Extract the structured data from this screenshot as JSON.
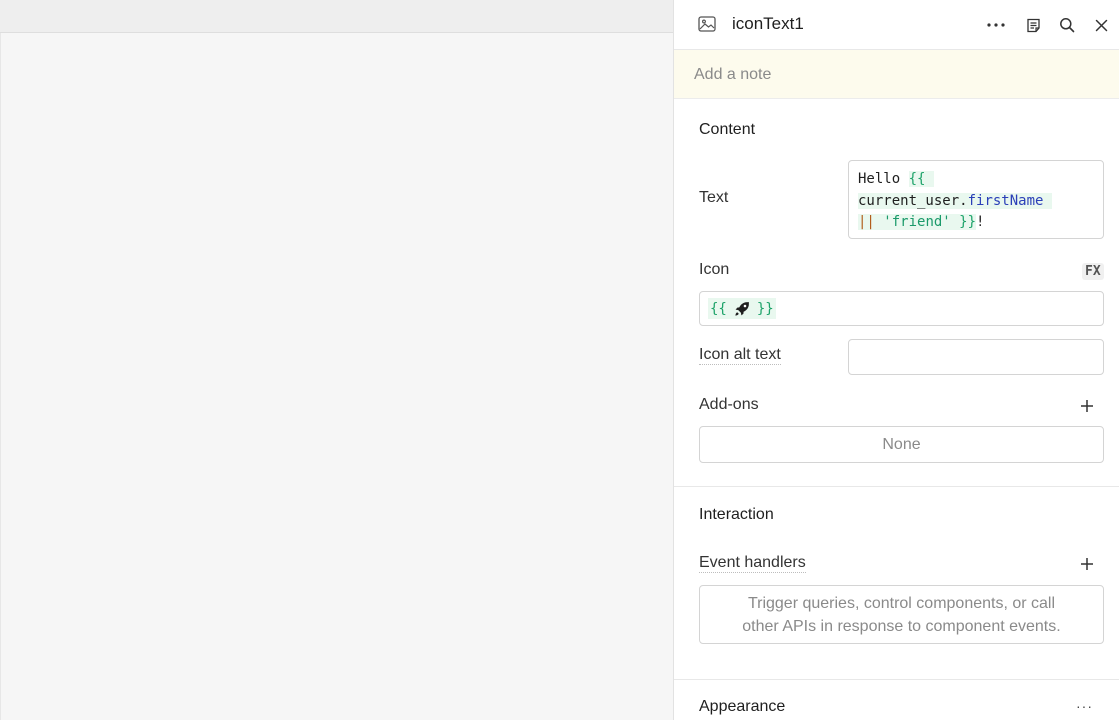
{
  "inspector": {
    "component_name": "iconText1",
    "note_placeholder": "Add a note",
    "content": {
      "title": "Content",
      "text_label": "Text",
      "text_code": {
        "l1_plain": "Hello ",
        "l1_brace": "{{",
        "l2_ident": "current_user",
        "l2_dot": ".",
        "l2_prop": "firstName",
        "l3_op": "||",
        "l3_str": "'friend'",
        "l3_brace": "}}",
        "l3_tail": "!"
      },
      "icon_label": "Icon",
      "fx_label": "FX",
      "icon_value": {
        "open": "{{",
        "icon": "rocket-icon",
        "close": "}}"
      },
      "icon_alt_label": "Icon alt text",
      "icon_alt_value": "",
      "addons_label": "Add-ons",
      "addons_value": "None"
    },
    "interaction": {
      "title": "Interaction",
      "event_handlers_label": "Event handlers",
      "empty_text_line1": "Trigger queries, control components, or call",
      "empty_text_line2": "other APIs in response to component events."
    },
    "appearance": {
      "title": "Appearance",
      "more": "···"
    },
    "header_more": "···"
  },
  "colors": {
    "accent_green": "#1ea36a",
    "property_blue": "#2b3fb8",
    "operator_orange": "#b25d1b",
    "note_bg": "#fdfbed"
  }
}
